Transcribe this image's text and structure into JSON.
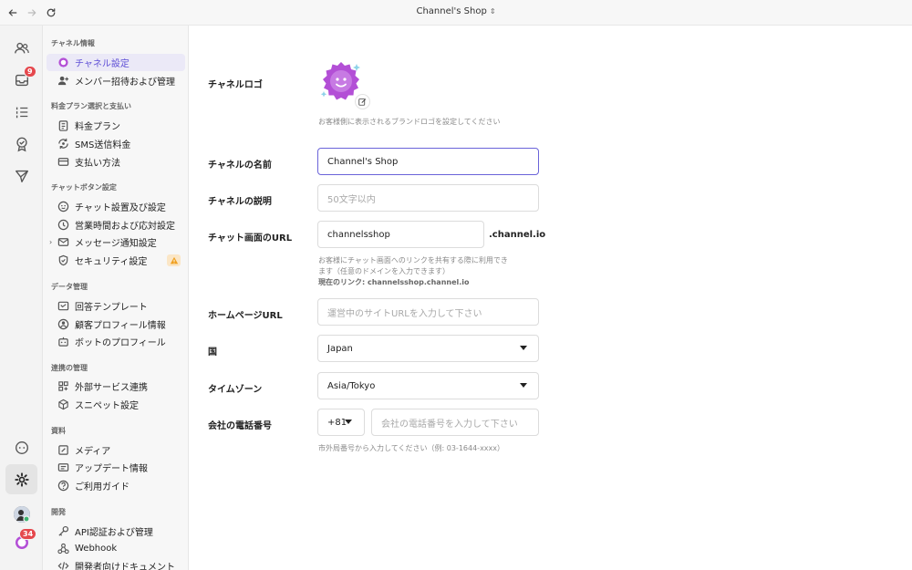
{
  "window": {
    "title": "Channel's Shop",
    "title_chevron": "⇕"
  },
  "rail": {
    "inbox_badge": "9",
    "notification_badge": "34"
  },
  "sidebar": {
    "sections": [
      {
        "title": "チャネル情報",
        "items": [
          "チャネル設定",
          "メンバー招待および管理"
        ]
      },
      {
        "title": "料金プラン選択と支払い",
        "items": [
          "料金プラン",
          "SMS送信料金",
          "支払い方法"
        ]
      },
      {
        "title": "チャットボタン設定",
        "items": [
          "チャット設置及び設定",
          "営業時間および応対設定",
          "メッセージ通知設定",
          "セキュリティ設定"
        ]
      },
      {
        "title": "データ管理",
        "items": [
          "回答テンプレート",
          "顧客プロフィール情報",
          "ボットのプロフィール"
        ]
      },
      {
        "title": "連携の管理",
        "items": [
          "外部サービス連携",
          "スニペット設定"
        ]
      },
      {
        "title": "資料",
        "items": [
          "メディア",
          "アップデート情報",
          "ご利用ガイド"
        ]
      },
      {
        "title": "開発",
        "items": [
          "API認証および管理",
          "Webhook",
          "開発者向けドキュメント"
        ]
      }
    ]
  },
  "form": {
    "logo": {
      "label": "チャネルロゴ",
      "help": "お客様側に表示されるブランドロゴを設定してください"
    },
    "name": {
      "label": "チャネルの名前",
      "value": "Channel's Shop"
    },
    "description": {
      "label": "チャネルの説明",
      "placeholder": "50文字以内"
    },
    "chat_url": {
      "label": "チャット画面のURL",
      "value": "channelsshop",
      "suffix": ".channel.io",
      "help_line1": "お客様にチャット画面へのリンクを共有する際に利用でき",
      "help_line2": "ます（任意のドメインを入力できます）",
      "current_link": "現在のリンク: channelsshop.channel.io"
    },
    "homepage": {
      "label": "ホームページURL",
      "placeholder": "運営中のサイトURLを入力して下さい"
    },
    "country": {
      "label": "国",
      "value": "Japan"
    },
    "timezone": {
      "label": "タイムゾーン",
      "value": "Asia/Tokyo"
    },
    "phone": {
      "label": "会社の電話番号",
      "country_code": "+81",
      "placeholder": "会社の電話番号を入力して下さい",
      "help": "市外局番号から入力してください（例: 03-1644-xxxx）"
    }
  },
  "colors": {
    "accent": "#6a63d9",
    "badge": "#e5484d",
    "logo": "#b34fd6"
  }
}
